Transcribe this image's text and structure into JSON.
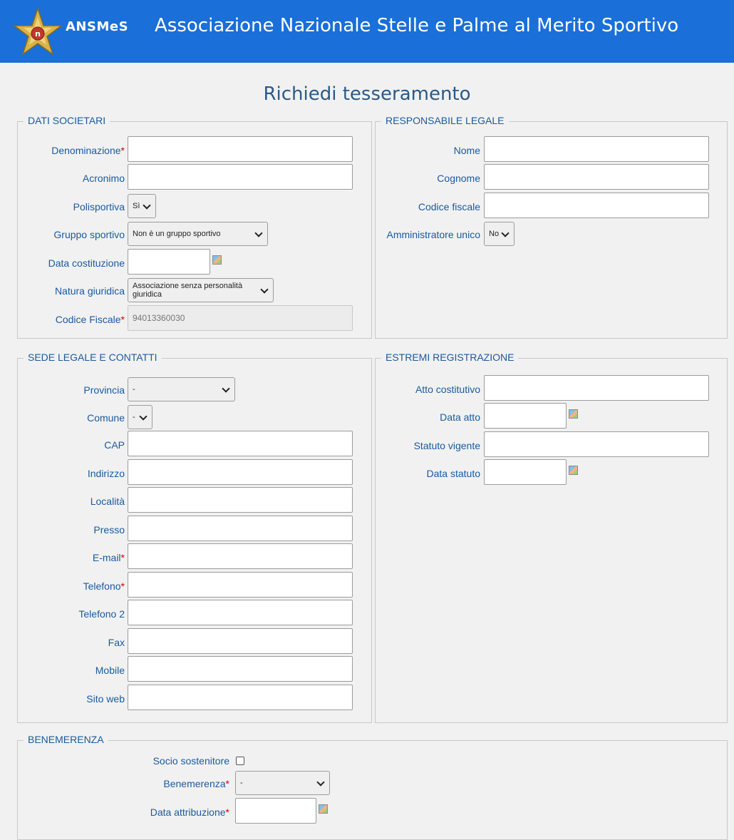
{
  "header": {
    "brand": "ANSMeS",
    "title": "Associazione Nazionale Stelle e Palme al Merito Sportivo"
  },
  "page_title": "Richiedi tesseramento",
  "dati_societari": {
    "legend": "DATI SOCIETARI",
    "denominazione": "Denominazione",
    "acronimo": "Acronimo",
    "polisportiva": "Polisportiva",
    "polisportiva_value": "Sì",
    "gruppo_sportivo": "Gruppo sportivo",
    "gruppo_sportivo_value": "Non è un gruppo sportivo",
    "data_costituzione": "Data costituzione",
    "natura_giuridica": "Natura giuridica",
    "natura_giuridica_value": "Associazione senza personalità giuridica",
    "codice_fiscale": "Codice Fiscale",
    "codice_fiscale_value": "94013360030",
    "required_mark": "*"
  },
  "responsabile_legale": {
    "legend": "RESPONSABILE LEGALE",
    "nome": "Nome",
    "cognome": "Cognome",
    "codice_fiscale": "Codice fiscale",
    "amministratore_unico": "Amministratore unico",
    "amministratore_unico_value": "No"
  },
  "sede_legale": {
    "legend": "SEDE LEGALE E CONTATTI",
    "provincia": "Provincia",
    "provincia_value": "-",
    "comune": "Comune",
    "comune_value": "-",
    "cap": "CAP",
    "indirizzo": "Indirizzo",
    "localita": "Località",
    "presso": "Presso",
    "email": "E-mail",
    "telefono": "Telefono",
    "telefono2": "Telefono 2",
    "fax": "Fax",
    "mobile": "Mobile",
    "sito_web": "Sito web"
  },
  "estremi_registrazione": {
    "legend": "ESTREMI REGISTRAZIONE",
    "atto_costitutivo": "Atto costitutivo",
    "data_atto": "Data atto",
    "statuto_vigente": "Statuto vigente",
    "data_statuto": "Data statuto"
  },
  "benemerenza": {
    "legend": "BENEMERENZA",
    "socio_sostenitore": "Socio sostenitore",
    "benemerenza": "Benemerenza",
    "benemerenza_value": "-",
    "data_attribuzione": "Data attribuzione"
  },
  "colors": {
    "header_bg": "#1a6fd8",
    "label": "#1a5aa0",
    "required": "#d00000"
  }
}
